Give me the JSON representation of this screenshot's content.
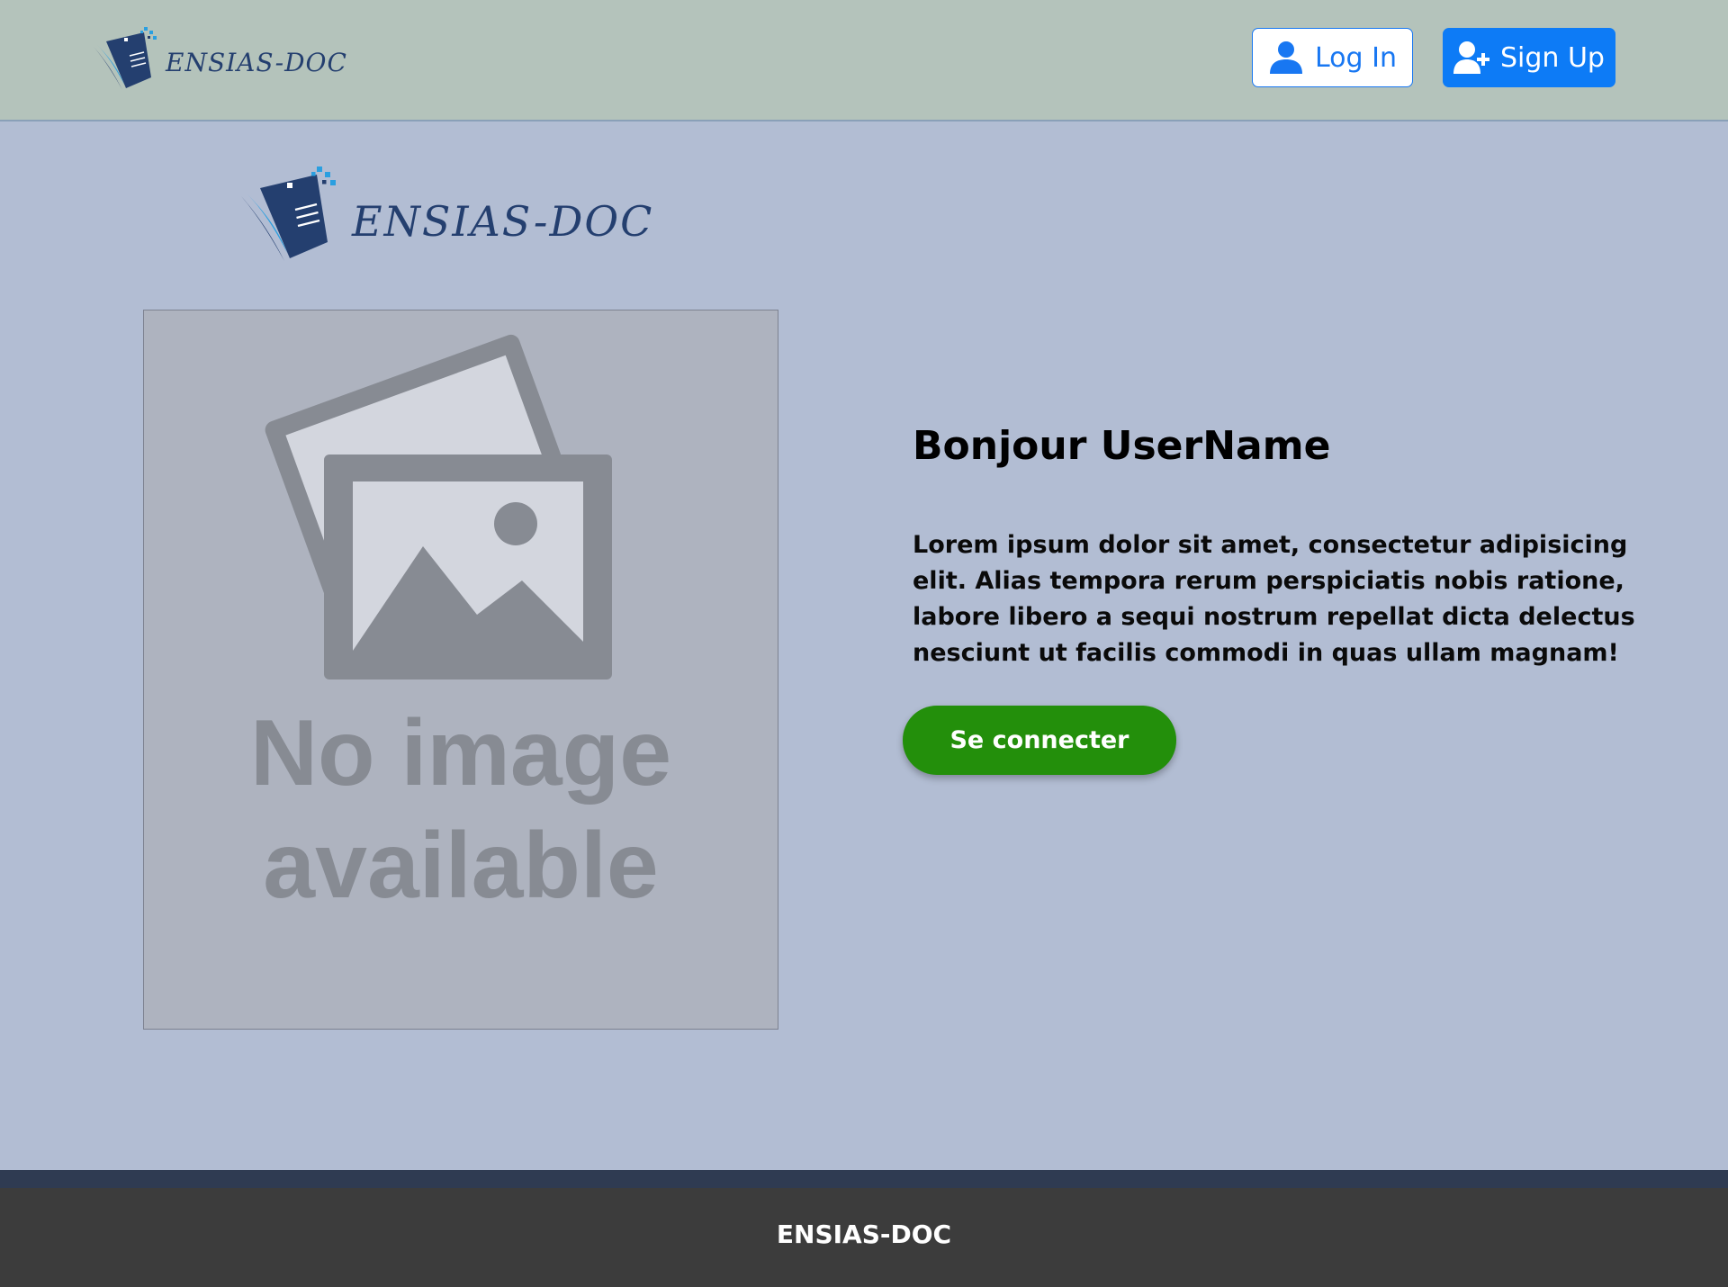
{
  "header": {
    "logo": {
      "text": "ENSIAS-DOC",
      "icon": "document-logo-icon"
    },
    "login_label": "Log In",
    "login_icon": "user-icon",
    "signup_label": "Sign Up",
    "signup_icon": "user-plus-icon"
  },
  "main": {
    "logo": {
      "text": "ENSIAS-DOC",
      "icon": "document-logo-icon"
    },
    "image": {
      "line1": "No image",
      "line2": "available",
      "icon": "image-placeholder-icon"
    },
    "greeting": "Bonjour UserName",
    "description": "Lorem ipsum dolor sit amet, consectetur adipisicing elit. Alias tempora rerum perspiciatis nobis ratione, labore libero a sequi nostrum repellat dicta delectus nesciunt ut facilis commodi in quas ullam magnam!",
    "connect_label": "Se connecter"
  },
  "footer": {
    "text": "ENSIAS-DOC"
  },
  "colors": {
    "header_bg": "#b4c3bb",
    "page_bg": "#b2bdd3",
    "primary_blue": "#0d7bf6",
    "connect_green": "#238f0b",
    "footer_bg": "#3c3c3c",
    "logo_navy": "#243f6f"
  }
}
